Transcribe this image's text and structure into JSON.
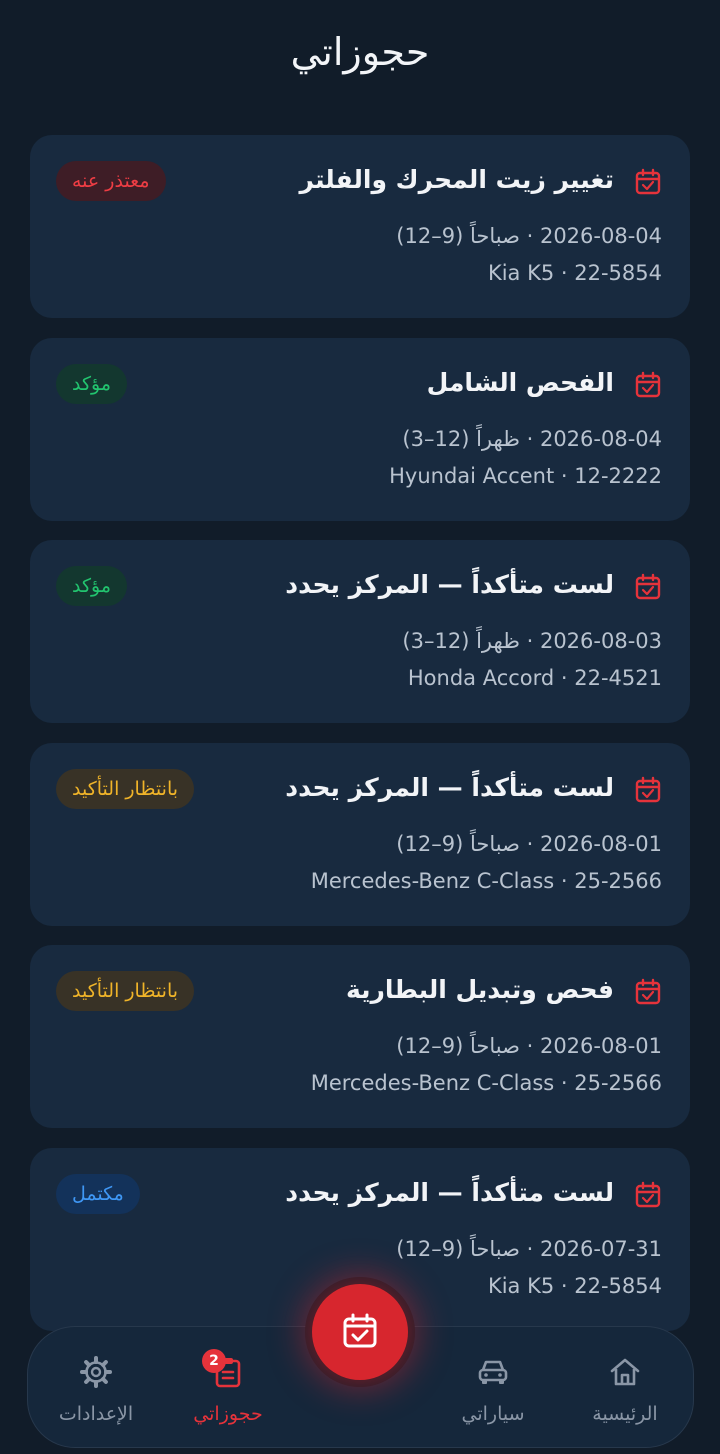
{
  "page": {
    "title": "حجوزاتي"
  },
  "colors": {
    "background": "#111c29",
    "card": "#182a3f",
    "accent": "#e5333b",
    "cancelled": "#ee3d44",
    "confirmed": "#22c46f",
    "pending": "#f0b429",
    "completed": "#3f97f4"
  },
  "bookings": [
    {
      "title": "تغيير زيت المحرك والفلتر",
      "datetime": "2026-08-04 · صباحاً (9–12)",
      "vehicle": "Kia K5 · 22-5854",
      "status": "معتذر عنه",
      "status_type": "cancelled",
      "icon": "calendar-check-icon"
    },
    {
      "title": "الفحص الشامل",
      "datetime": "2026-08-04 · ظهراً (12–3)",
      "vehicle": "Hyundai Accent · 12-2222",
      "status": "مؤكد",
      "status_type": "confirmed",
      "icon": "calendar-check-icon"
    },
    {
      "title": "لست متأكداً — المركز يحدد",
      "datetime": "2026-08-03 · ظهراً (12–3)",
      "vehicle": "Honda Accord · 22-4521",
      "status": "مؤكد",
      "status_type": "confirmed",
      "icon": "calendar-check-icon"
    },
    {
      "title": "لست متأكداً — المركز يحدد",
      "datetime": "2026-08-01 · صباحاً (9–12)",
      "vehicle": "Mercedes-Benz C-Class · 25-2566",
      "status": "بانتظار التأكيد",
      "status_type": "pending",
      "icon": "calendar-check-icon"
    },
    {
      "title": "فحص وتبديل البطارية",
      "datetime": "2026-08-01 · صباحاً (9–12)",
      "vehicle": "Mercedes-Benz C-Class · 25-2566",
      "status": "بانتظار التأكيد",
      "status_type": "pending",
      "icon": "calendar-check-icon"
    },
    {
      "title": "لست متأكداً — المركز يحدد",
      "datetime": "2026-07-31 · صباحاً (9–12)",
      "vehicle": "Kia K5 · 22-5854",
      "status": "مكتمل",
      "status_type": "completed",
      "icon": "calendar-check-icon"
    }
  ],
  "nav": {
    "home": {
      "label": "الرئيسية",
      "icon": "home-icon"
    },
    "cars": {
      "label": "سياراتي",
      "icon": "car-icon"
    },
    "bookings": {
      "label": "حجوزاتي",
      "icon": "clipboard-icon",
      "badge": "2",
      "active": true
    },
    "settings": {
      "label": "الإعدادات",
      "icon": "gear-icon"
    },
    "fab": {
      "icon": "calendar-check-icon"
    }
  }
}
